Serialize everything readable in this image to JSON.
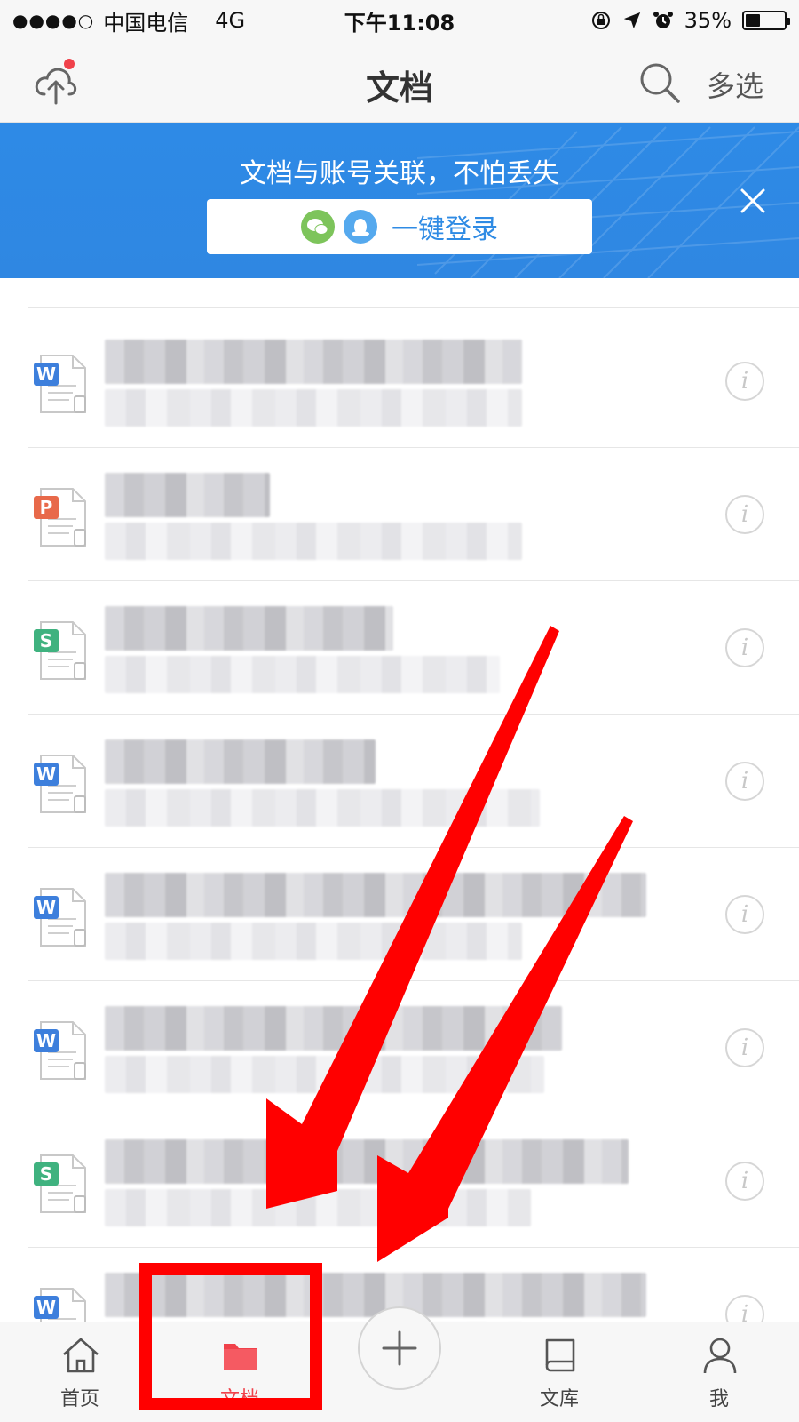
{
  "status_bar": {
    "signal": "●●●●○",
    "carrier": "中国电信",
    "network": "4G",
    "time": "下午11:08",
    "battery_percent": "35%",
    "battery_level": 0.35
  },
  "nav": {
    "title": "文档",
    "multi_select": "多选",
    "upload_icon": "cloud-upload-icon",
    "search_icon": "search-icon"
  },
  "banner": {
    "text": "文档与账号关联，不怕丢失",
    "login_label": "一键登录",
    "close_icon": "close-icon"
  },
  "documents": [
    {
      "type": "W",
      "color": "#3d7fdc"
    },
    {
      "type": "P",
      "color": "#e8694a"
    },
    {
      "type": "S",
      "color": "#3fb27f"
    },
    {
      "type": "W",
      "color": "#3d7fdc"
    },
    {
      "type": "W",
      "color": "#3d7fdc"
    },
    {
      "type": "W",
      "color": "#3d7fdc"
    },
    {
      "type": "S",
      "color": "#3fb27f"
    },
    {
      "type": "W",
      "color": "#3d7fdc"
    }
  ],
  "tabs": [
    {
      "label": "首页",
      "icon": "home-icon"
    },
    {
      "label": "文档",
      "icon": "folder-icon",
      "active": true
    },
    {
      "label": "文库",
      "icon": "book-icon"
    },
    {
      "label": "我",
      "icon": "user-icon"
    }
  ],
  "colors": {
    "accent": "#f0414a",
    "banner_blue": "#2f87e2",
    "annotation_red": "#ff0000"
  }
}
